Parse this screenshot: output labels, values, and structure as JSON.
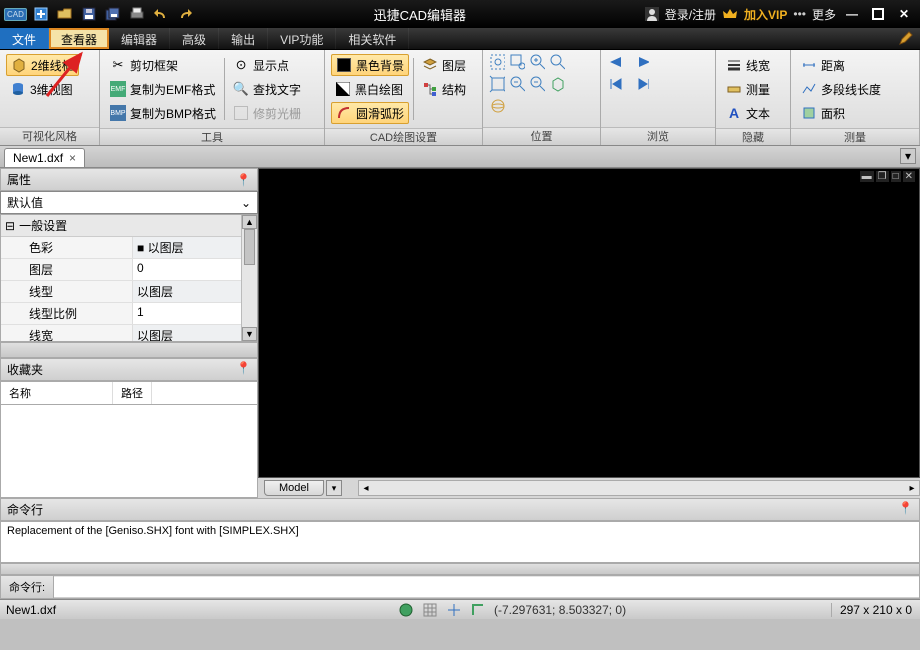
{
  "titlebar": {
    "app_icon_text": "CAD",
    "title": "迅捷CAD编辑器",
    "login": "登录/注册",
    "vip": "加入VIP",
    "more": "更多"
  },
  "menu": {
    "file": "文件",
    "viewer": "查看器",
    "editor": "编辑器",
    "advanced": "高级",
    "output": "输出",
    "vip": "VIP功能",
    "related": "相关软件"
  },
  "ribbon": {
    "grp1_label": "可视化风格",
    "grp1_a": "2维线框",
    "grp1_b": "3维视图",
    "grp2_label": "工具",
    "grp2_a": "剪切框架",
    "grp2_b": "复制为EMF格式",
    "grp2_c": "复制为BMP格式",
    "grp2_d": "显示点",
    "grp2_e": "查找文字",
    "grp2_f": "修剪光栅",
    "grp3_label": "CAD绘图设置",
    "grp3_a": "黑色背景",
    "grp3_b": "黑白绘图",
    "grp3_c": "圆滑弧形",
    "grp3_d": "图层",
    "grp3_e": "结构",
    "grp4_label": "位置",
    "grp5_label": "浏览",
    "grp6_label": "隐藏",
    "grp6_a": "线宽",
    "grp6_b": "测量",
    "grp6_c": "文本",
    "grp7_label": "测量",
    "grp7_a": "距离",
    "grp7_b": "多段线长度",
    "grp7_c": "面积"
  },
  "doc": {
    "tab": "New1.dxf"
  },
  "props": {
    "title": "属性",
    "combo": "默认值",
    "section": "一般设置",
    "rows": [
      {
        "k": "色彩",
        "v": "■ 以图层"
      },
      {
        "k": "图层",
        "v": "0"
      },
      {
        "k": "线型",
        "v": "以图层"
      },
      {
        "k": "线型比例",
        "v": "1"
      },
      {
        "k": "线宽",
        "v": "以图层"
      }
    ]
  },
  "fav": {
    "title": "收藏夹",
    "col1": "名称",
    "col2": "路径"
  },
  "model": {
    "tab": "Model"
  },
  "cmd": {
    "title": "命令行",
    "log": "Replacement of the [Geniso.SHX] font with [SIMPLEX.SHX]",
    "label": "命令行:"
  },
  "status": {
    "file": "New1.dxf",
    "coords": "(-7.297631; 8.503327; 0)",
    "dims": "297 x 210 x 0"
  }
}
